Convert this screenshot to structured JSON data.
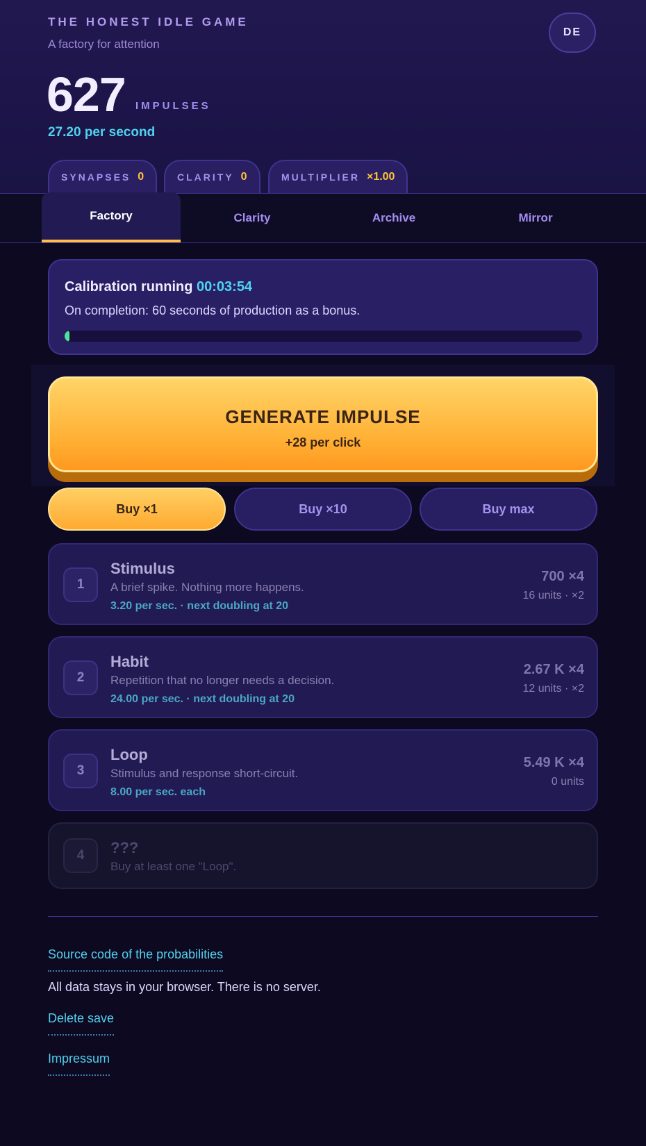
{
  "header": {
    "title": "THE HONEST IDLE GAME",
    "subtitle": "A factory for attention",
    "language_button": "DE",
    "score": "627",
    "score_unit": "IMPULSES",
    "rate": "27.20 per second"
  },
  "stats": [
    {
      "label": "SYNAPSES",
      "value": "0"
    },
    {
      "label": "CLARITY",
      "value": "0"
    },
    {
      "label": "MULTIPLIER",
      "value": "×1.00"
    }
  ],
  "tabs": [
    {
      "label": "Factory",
      "active": true
    },
    {
      "label": "Clarity",
      "active": false
    },
    {
      "label": "Archive",
      "active": false
    },
    {
      "label": "Mirror",
      "active": false
    }
  ],
  "calibration": {
    "title": "Calibration running",
    "timer": "00:03:54",
    "description": "On completion: 60 seconds of production as a bonus.",
    "progress": 0.008
  },
  "generate": {
    "label": "GENERATE IMPULSE",
    "sublabel": "+28 per click"
  },
  "buy_modes": [
    {
      "label": "Buy ×1",
      "active": true
    },
    {
      "label": "Buy ×10",
      "active": false
    },
    {
      "label": "Buy max",
      "active": false
    }
  ],
  "generators": [
    {
      "number": "1",
      "name": "Stimulus",
      "description": "A brief spike. Nothing more happens.",
      "rate": "3.20 per sec. · next doubling at 20",
      "price": "700 ×4",
      "units": "16 units · ×2"
    },
    {
      "number": "2",
      "name": "Habit",
      "description": "Repetition that no longer needs a decision.",
      "rate": "24.00 per sec. · next doubling at 20",
      "price": "2.67 K ×4",
      "units": "12 units · ×2"
    },
    {
      "number": "3",
      "name": "Loop",
      "description": "Stimulus and response short-circuit.",
      "rate": "8.00 per sec. each",
      "price": "5.49 K ×4",
      "units": "0 units"
    },
    {
      "number": "4",
      "name": "???",
      "description": "Buy at least one \"Loop\".",
      "locked": true
    }
  ],
  "footer": {
    "source_link": "Source code of the probabilities",
    "privacy_text": "All data stays in your browser. There is no server.",
    "delete_link": "Delete save",
    "impressum_link": "Impressum"
  },
  "colors": {
    "accent_gold": "#ffb73d",
    "accent_cyan": "#4fd3f0",
    "background": "#0c0920",
    "progress_green": "#4fe39b"
  }
}
